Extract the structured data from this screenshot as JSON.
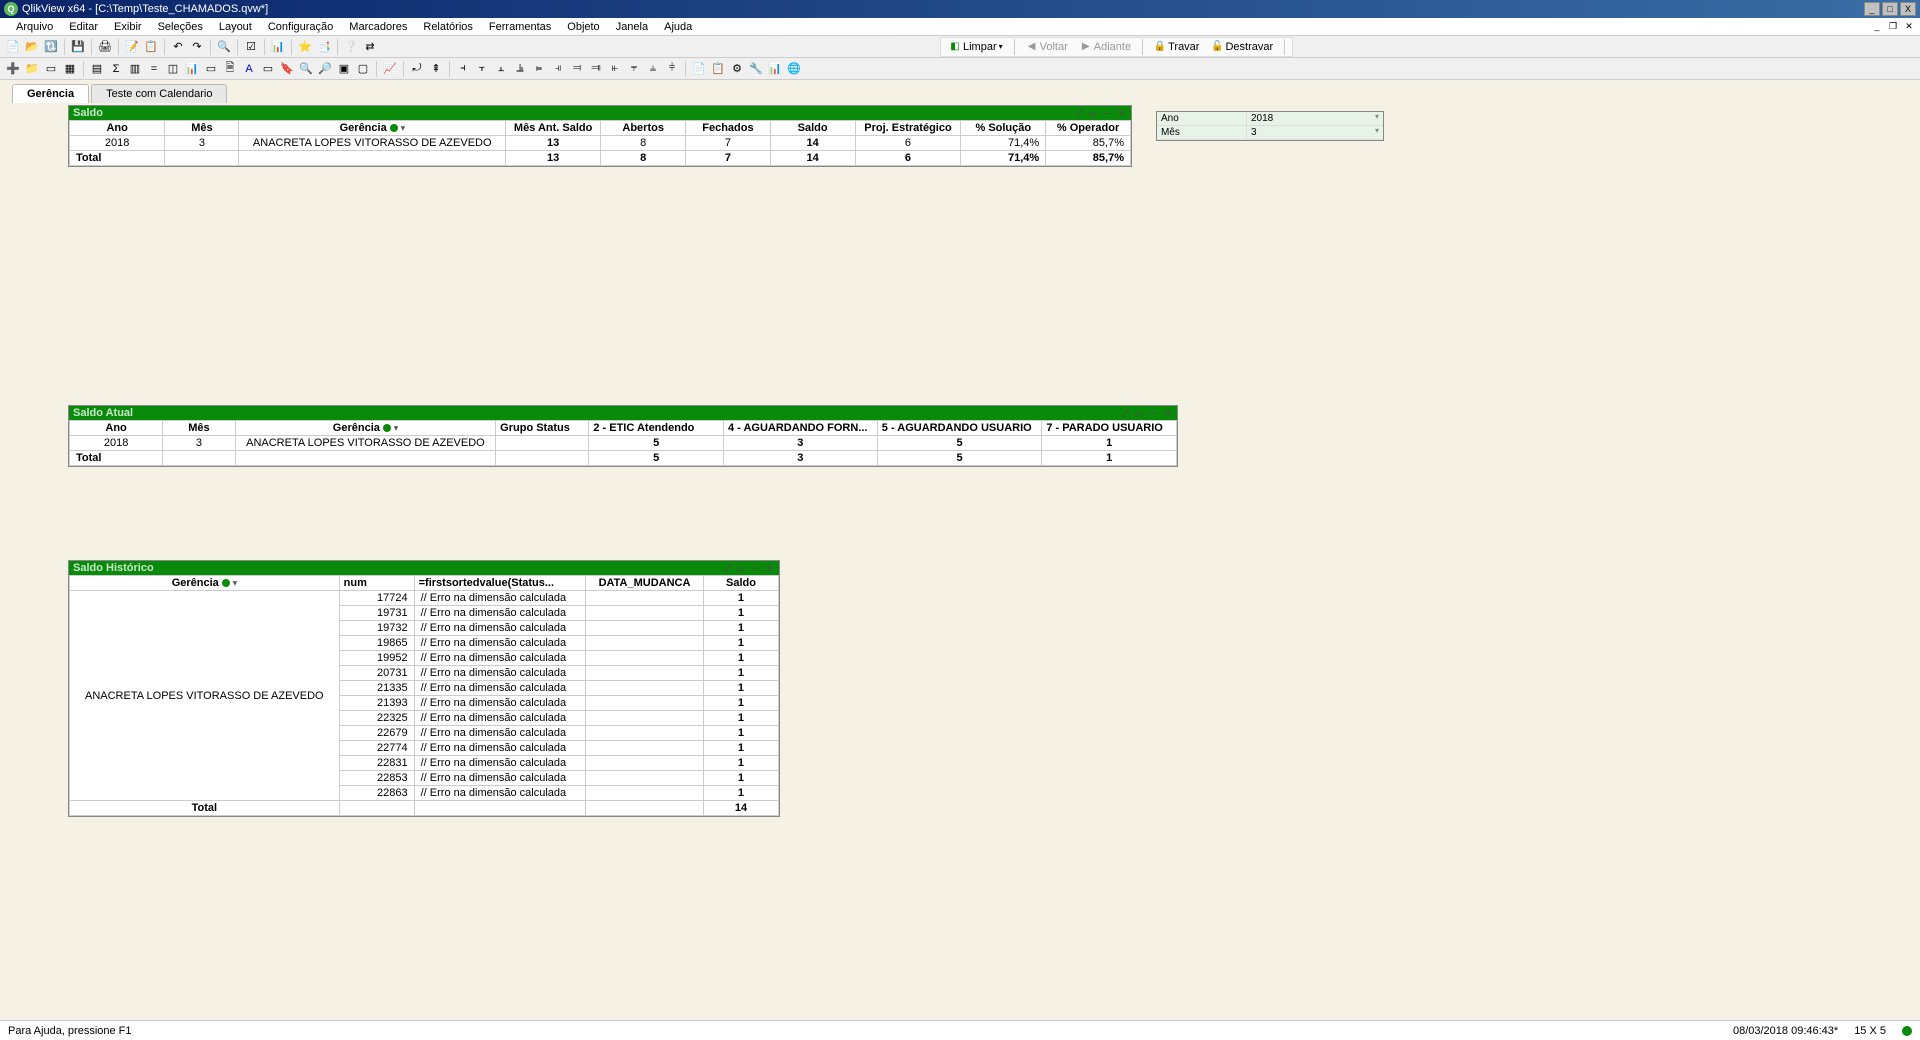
{
  "window": {
    "app_icon_letter": "Q",
    "title": "QlikView x64 - [C:\\Temp\\Teste_CHAMADOS.qvw*]"
  },
  "menu": {
    "items": [
      "Arquivo",
      "Editar",
      "Exibir",
      "Seleções",
      "Layout",
      "Configuração",
      "Marcadores",
      "Relatórios",
      "Ferramentas",
      "Objeto",
      "Janela",
      "Ajuda"
    ]
  },
  "nav": {
    "limpar": "Limpar",
    "voltar": "Voltar",
    "adiante": "Adiante",
    "travar": "Travar",
    "destravar": "Destravar"
  },
  "tabs": {
    "active": "Gerência",
    "other": "Teste com Calendario"
  },
  "saldo": {
    "title": "Saldo",
    "headers": [
      "Ano",
      "Mês",
      "Gerência",
      "Mês Ant. Saldo",
      "Abertos",
      "Fechados",
      "Saldo",
      "Proj. Estratégico",
      "% Solução",
      "% Operador"
    ],
    "row": {
      "ano": "2018",
      "mes": "3",
      "ger": "ANACRETA LOPES VITORASSO DE AZEVEDO",
      "mesant": "13",
      "abertos": "8",
      "fechados": "7",
      "saldo_v": "14",
      "proj": "6",
      "sol": "71,4%",
      "op": "85,7%"
    },
    "total_label": "Total",
    "total": {
      "mesant": "13",
      "abertos": "8",
      "fechados": "7",
      "saldo_v": "14",
      "proj": "6",
      "sol": "71,4%",
      "op": "85,7%"
    }
  },
  "saldo_atual": {
    "title": "Saldo Atual",
    "headers": [
      "Ano",
      "Mês",
      "Gerência",
      "Grupo Status",
      "2 - ETIC Atendendo",
      "4 - AGUARDANDO FORN...",
      "5 - AGUARDANDO USUARIO",
      "7 - PARADO USUARIO"
    ],
    "row": {
      "ano": "2018",
      "mes": "3",
      "ger": "ANACRETA LOPES VITORASSO DE AZEVEDO",
      "c2": "5",
      "c4": "3",
      "c5": "5",
      "c7": "1"
    },
    "total_label": "Total",
    "total": {
      "c2": "5",
      "c4": "3",
      "c5": "5",
      "c7": "1"
    }
  },
  "saldo_hist": {
    "title": "Saldo Histórico",
    "headers": [
      "Gerência",
      "num",
      "=firstsortedvalue(Status...",
      "DATA_MUDANCA",
      "Saldo"
    ],
    "ger": "ANACRETA LOPES VITORASSO DE AZEVEDO",
    "error_text": "// Erro na dimensão calculada",
    "rows": [
      {
        "num": "17724",
        "saldo": "1"
      },
      {
        "num": "19731",
        "saldo": "1"
      },
      {
        "num": "19732",
        "saldo": "1"
      },
      {
        "num": "19865",
        "saldo": "1"
      },
      {
        "num": "19952",
        "saldo": "1"
      },
      {
        "num": "20731",
        "saldo": "1"
      },
      {
        "num": "21335",
        "saldo": "1"
      },
      {
        "num": "21393",
        "saldo": "1"
      },
      {
        "num": "22325",
        "saldo": "1"
      },
      {
        "num": "22679",
        "saldo": "1"
      },
      {
        "num": "22774",
        "saldo": "1"
      },
      {
        "num": "22831",
        "saldo": "1"
      },
      {
        "num": "22853",
        "saldo": "1"
      },
      {
        "num": "22863",
        "saldo": "1"
      }
    ],
    "total_label": "Total",
    "total_saldo": "14"
  },
  "listbox": {
    "ano_label": "Ano",
    "ano_value": "2018",
    "mes_label": "Mês",
    "mes_value": "3"
  },
  "statusbar": {
    "help": "Para Ajuda, pressione F1",
    "datetime": "08/03/2018 09:46:43*",
    "dims": "15 X 5"
  },
  "title_icons_text": "⤢ ▭ — ✕"
}
